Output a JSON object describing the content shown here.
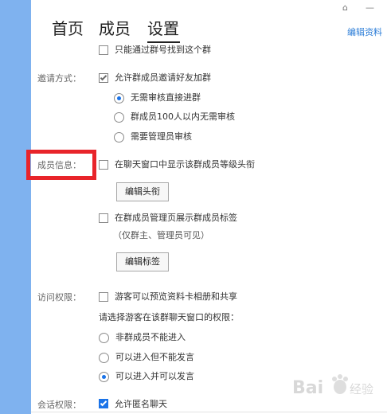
{
  "window": {
    "controls": {
      "home": "⌂",
      "minimize": "—"
    }
  },
  "nav": {
    "tabs": [
      {
        "label": "首页",
        "active": false
      },
      {
        "label": "成员",
        "active": false
      },
      {
        "label": "设置",
        "active": true
      }
    ],
    "edit_profile": "编辑资料"
  },
  "search": {
    "only_by_number": {
      "label": "只能通过群号找到这个群",
      "checked": false
    }
  },
  "invite": {
    "section_label": "邀请方式：",
    "allow_invite": {
      "label": "允许群成员邀请好友加群",
      "checked": true
    },
    "options": [
      {
        "label": "无需审核直接进群",
        "selected": true
      },
      {
        "label": "群成员100人以内无需审核",
        "selected": false
      },
      {
        "label": "需要管理员审核",
        "selected": false
      }
    ]
  },
  "member_info": {
    "section_label": "成员信息：",
    "show_level_title": {
      "label": "在聊天窗口中显示该群成员等级头衔",
      "checked": false
    },
    "edit_title_button": "编辑头衔",
    "show_member_tags": {
      "label": "在群成员管理页展示群成员标签",
      "checked": false
    },
    "tags_note": "（仅群主、管理员可见）",
    "edit_tags_button": "编辑标签"
  },
  "visit": {
    "section_label": "访问权限：",
    "guest_preview": {
      "label": "游客可以预览资料卡相册和共享",
      "checked": false
    },
    "prompt": "请选择游客在该群聊天窗口的权限：",
    "options": [
      {
        "label": "非群成员不能进入",
        "selected": false
      },
      {
        "label": "可以进入但不能发言",
        "selected": false
      },
      {
        "label": "可以进入并可以发言",
        "selected": true
      }
    ]
  },
  "session": {
    "section_label": "会话权限：",
    "anonymous_chat": {
      "label": "允许匿名聊天",
      "checked": true
    }
  },
  "watermark": {
    "text": "Bai",
    "suffix": "经验"
  },
  "colors": {
    "left_bar": "#7fb2ef",
    "accent_link": "#2a7cd7",
    "radio_selected": "#1a73e8",
    "highlight_box": "#e8242a"
  }
}
